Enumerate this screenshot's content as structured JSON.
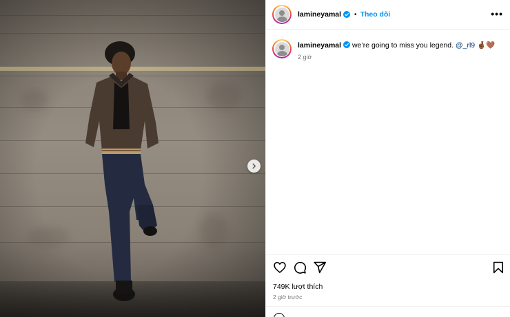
{
  "post": {
    "username": "lamineyamal",
    "dot": "•",
    "follow_label": "Theo dõi",
    "more_label": "•••",
    "caption_text": "we’re going to miss you legend.",
    "mention": "@_rl9",
    "caption_emoji": "🤞🏾🤎",
    "caption_time": "2 giờ",
    "likes": "749K lượt thích",
    "time_ago": "2 giờ trước"
  },
  "icons": [
    "verified-badge-icon",
    "heart-icon",
    "comment-icon",
    "share-icon",
    "bookmark-icon",
    "chevron-right-icon",
    "emoji-icon"
  ],
  "colors": {
    "accent": "#0095f6",
    "verified": "#0095f6",
    "mention": "#00376b",
    "muted": "#737373"
  }
}
